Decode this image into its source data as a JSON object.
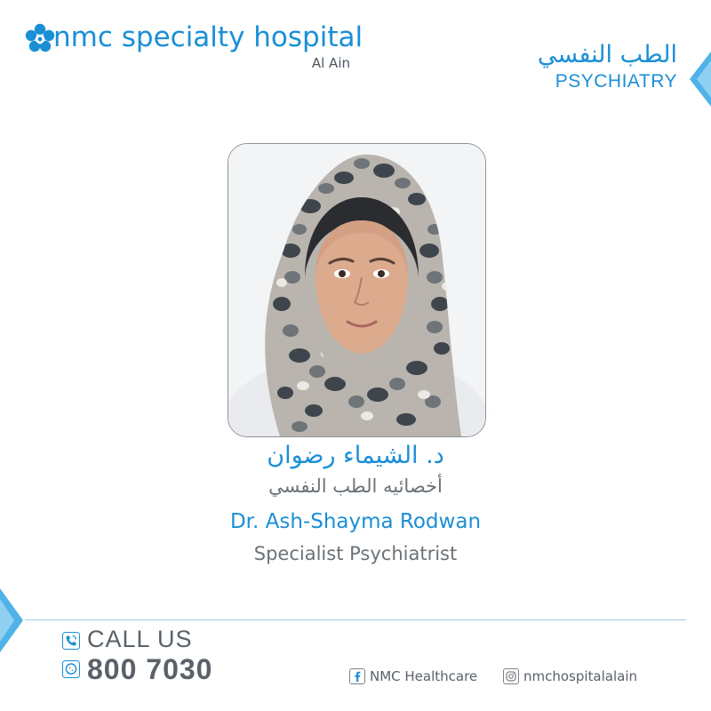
{
  "brand": {
    "name": "nmc specialty hospital",
    "location": "Al Ain",
    "color": "#1b8fd6"
  },
  "department": {
    "arabic": "الطب النفسي",
    "english": "PSYCHIATRY"
  },
  "doctor": {
    "name_ar": "د. الشيماء رضوان",
    "title_ar": "أخصائيه الطب النفسي",
    "name_en": "Dr. Ash-Shayma Rodwan",
    "title_en": "Specialist Psychiatrist"
  },
  "contact": {
    "call_label": "CALL US",
    "phone": "800 7030",
    "phone_icon": "phone-icon",
    "whatsapp_icon": "whatsapp-icon"
  },
  "social": {
    "facebook": {
      "icon": "facebook-icon",
      "handle": "NMC Healthcare"
    },
    "instagram": {
      "icon": "instagram-icon",
      "handle": "nmchospitalalain"
    }
  }
}
